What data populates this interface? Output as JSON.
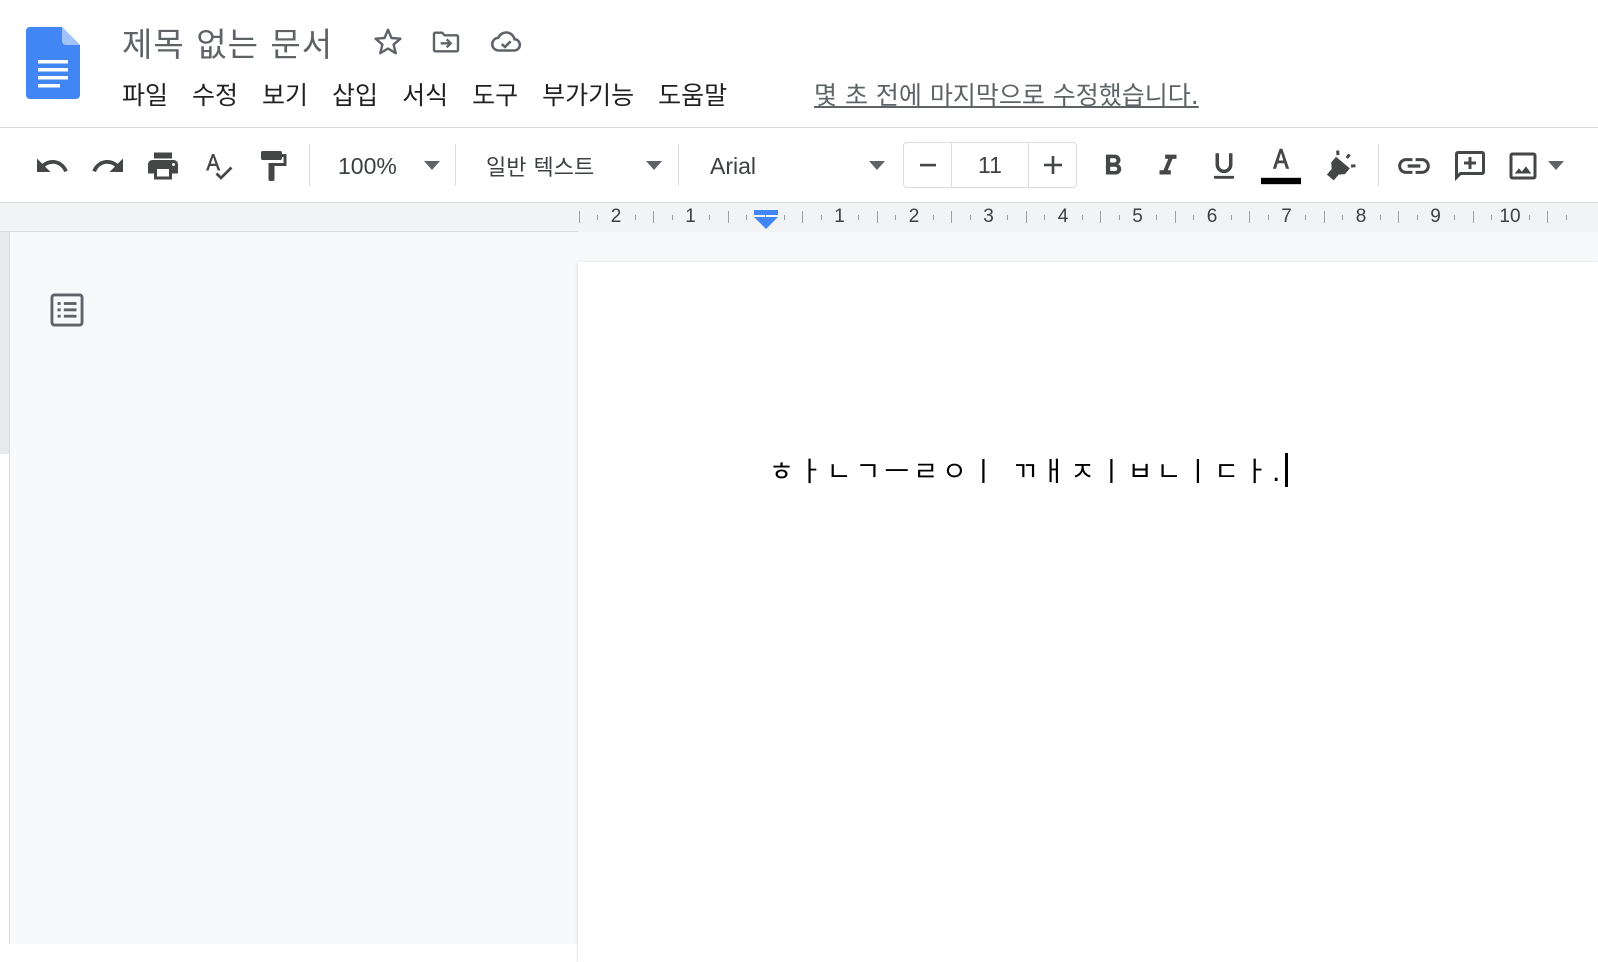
{
  "header": {
    "title": "제목 없는 문서",
    "menu": [
      "파일",
      "수정",
      "보기",
      "삽입",
      "서식",
      "도구",
      "부가기능",
      "도움말"
    ],
    "last_edit": "몇 초 전에 마지막으로 수정했습니다."
  },
  "toolbar": {
    "zoom": "100%",
    "style": "일반 텍스트",
    "font": "Arial",
    "font_size": "11",
    "minus": "−",
    "plus": "+"
  },
  "ruler": {
    "labels": [
      "2",
      "1",
      "1",
      "2",
      "3",
      "4",
      "5",
      "6",
      "7",
      "8",
      "9",
      "10"
    ]
  },
  "document": {
    "text": "ㅎㅏㄴㄱㅡㄹㅇㅣ ㄲㅐㅈㅣㅂㄴㅣㄷㅏ."
  },
  "colors": {
    "docs_blue": "#4285f4",
    "text_color_bar": "#000000",
    "indent_marker": "#4285f4"
  },
  "icons": [
    "docs-logo-icon",
    "star-icon",
    "move-to-folder-icon",
    "cloud-saved-icon",
    "undo-icon",
    "redo-icon",
    "print-icon",
    "spellcheck-icon",
    "paint-format-icon",
    "bold-icon",
    "italic-icon",
    "underline-icon",
    "text-color-icon",
    "highlight-icon",
    "link-icon",
    "add-comment-icon",
    "insert-image-icon",
    "document-outline-icon"
  ]
}
